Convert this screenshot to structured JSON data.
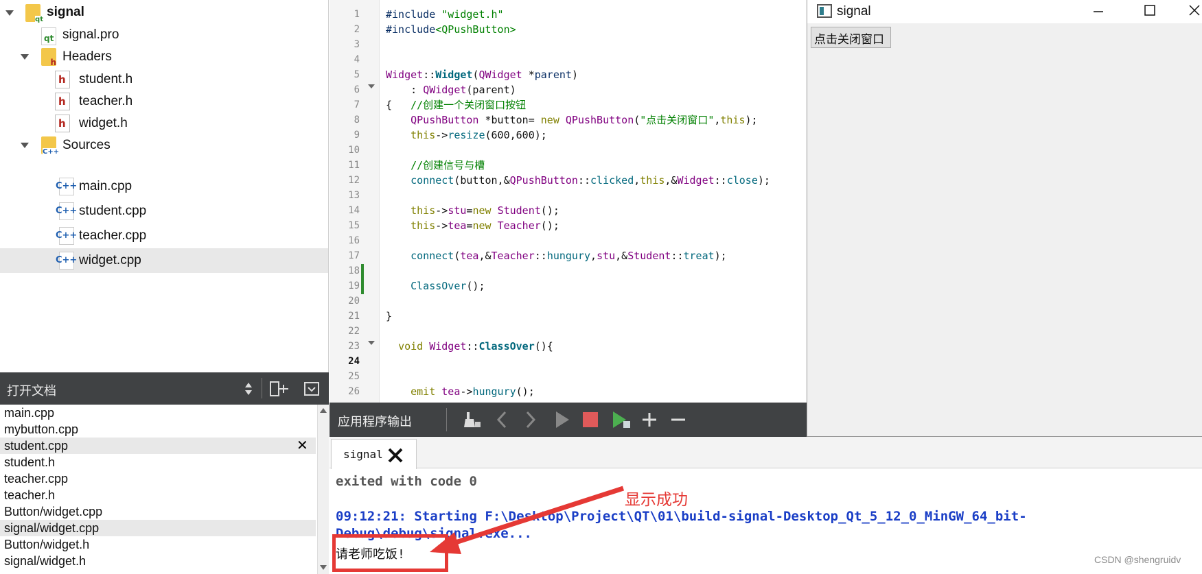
{
  "project_tree": {
    "root": "signal",
    "items": [
      {
        "label": "signal.pro"
      },
      {
        "label": "Headers"
      },
      {
        "label": "student.h"
      },
      {
        "label": "teacher.h"
      },
      {
        "label": "widget.h"
      },
      {
        "label": "Sources"
      },
      {
        "label": "main.cpp"
      },
      {
        "label": "student.cpp"
      },
      {
        "label": "teacher.cpp"
      },
      {
        "label": "widget.cpp"
      }
    ],
    "icon_text": {
      "qt": "qt",
      "h": "h",
      "cpp": "C++",
      "sources": "C++"
    }
  },
  "open_documents": {
    "title": "打开文档",
    "items": [
      "main.cpp",
      "mybutton.cpp",
      "student.cpp",
      "student.h",
      "teacher.cpp",
      "teacher.h",
      "Button/widget.cpp",
      "signal/widget.cpp",
      "Button/widget.h",
      "signal/widget.h"
    ],
    "close_glyph": "✕"
  },
  "editor": {
    "line_numbers": [
      "1",
      "2",
      "3",
      "4",
      "5",
      "6",
      "7",
      "8",
      "9",
      "10",
      "11",
      "12",
      "13",
      "14",
      "15",
      "16",
      "17",
      "18",
      "19",
      "20",
      "21",
      "22",
      "23",
      "24",
      "25",
      "26"
    ],
    "code": {
      "l1a": "#include ",
      "l1b": "\"widget.h\"",
      "l2a": "#include",
      "l2b": "<QPushButton>",
      "l5a": "Widget",
      "l5b": "::",
      "l5c": "Widget",
      "l5d": "(",
      "l5e": "QWidget",
      "l5f": " *",
      "l5g": "parent",
      "l5h": ")",
      "l6a": "    : ",
      "l6b": "QWidget",
      "l6c": "(parent)",
      "l7a": "{   ",
      "l7b": "//创建一个关闭窗口按钮",
      "l8a": "    ",
      "l8b": "QPushButton",
      "l8c": " *button= ",
      "l8d": "new",
      "l8e": " ",
      "l8f": "QPushButton",
      "l8g": "(",
      "l8h": "\"点击关闭窗口\"",
      "l8i": ",",
      "l8j": "this",
      "l8k": ");",
      "l9a": "    ",
      "l9b": "this",
      "l9c": "->",
      "l9d": "resize",
      "l9e": "(600,600);",
      "l11a": "    ",
      "l11b": "//创建信号与槽",
      "l12a": "    ",
      "l12b": "connect",
      "l12c": "(button,&",
      "l12d": "QPushButton",
      "l12e": "::",
      "l12f": "clicked",
      "l12g": ",",
      "l12h": "this",
      "l12i": ",&",
      "l12j": "Widget",
      "l12k": "::",
      "l12l": "close",
      "l12m": ");",
      "l14a": "    ",
      "l14b": "this",
      "l14c": "->",
      "l14d": "stu",
      "l14e": "=",
      "l14f": "new",
      "l14g": " ",
      "l14h": "Student",
      "l14i": "();",
      "l15a": "    ",
      "l15b": "this",
      "l15c": "->",
      "l15d": "tea",
      "l15e": "=",
      "l15f": "new",
      "l15g": " ",
      "l15h": "Teacher",
      "l15i": "();",
      "l17a": "    ",
      "l17b": "connect",
      "l17c": "(",
      "l17d": "tea",
      "l17e": ",&",
      "l17f": "Teacher",
      "l17g": "::",
      "l17h": "hungury",
      "l17i": ",",
      "l17j": "stu",
      "l17k": ",&",
      "l17l": "Student",
      "l17m": "::",
      "l17n": "treat",
      "l17o": ");",
      "l19a": "    ",
      "l19b": "ClassOver",
      "l19c": "();",
      "l21a": "}",
      "l23a": "  ",
      "l23b": "void",
      "l23c": " ",
      "l23d": "Widget",
      "l23e": "::",
      "l23f": "ClassOver",
      "l23g": "(){",
      "l26a": "    ",
      "l26b": "emit",
      "l26c": " ",
      "l26d": "tea",
      "l26e": "->",
      "l26f": "hungury",
      "l26g": "();"
    }
  },
  "output_panel": {
    "title": "应用程序输出",
    "tab_label": "signal",
    "lines": {
      "exited": "exited with code 0",
      "starting": "09:12:21: Starting F:\\Desktop\\Project\\QT\\01\\build-signal-Desktop_Qt_5_12_0_MinGW_64_bit-",
      "path2": "Debug\\debug\\signal.exe...",
      "result": "请老师吃饭!"
    }
  },
  "app_window": {
    "title": "signal",
    "button_label": "点击关闭窗口"
  },
  "annotation": {
    "label": "显示成功",
    "color": "#e53935"
  },
  "watermark": "CSDN @shengruidv"
}
